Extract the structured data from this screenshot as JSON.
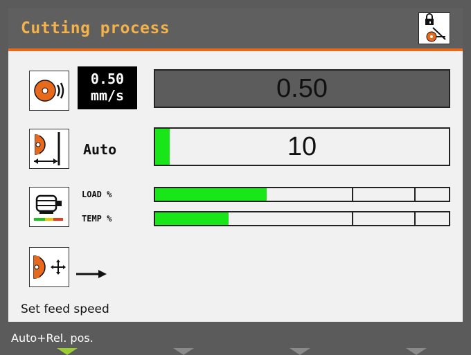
{
  "header": {
    "title": "Cutting process",
    "lock_icon": "lock-icon"
  },
  "speed_row": {
    "icon": "saw-blade-speed-icon",
    "badge_value": "0.50",
    "badge_unit": "mm/s",
    "display_value": "0.50"
  },
  "feed_row": {
    "icon": "feed-distance-icon",
    "mode": "Auto",
    "display_value": "10",
    "progress_fraction": 0.05
  },
  "motor_row": {
    "icon": "motor-icon",
    "load_label": "LOAD %",
    "temp_label": "TEMP %",
    "load_fraction": 0.38,
    "temp_fraction": 0.25
  },
  "position_row": {
    "icon": "position-move-icon",
    "arrow_icon": "arrow-right-icon"
  },
  "status": {
    "text": "Set feed speed"
  },
  "softkeys": {
    "label": "Auto+Rel. pos.",
    "colors": {
      "active": "#9acd32",
      "inactive": "#8a8a8a"
    }
  },
  "colors": {
    "accent": "#e8691c",
    "title": "#f4b24a",
    "fill": "#19e619"
  }
}
